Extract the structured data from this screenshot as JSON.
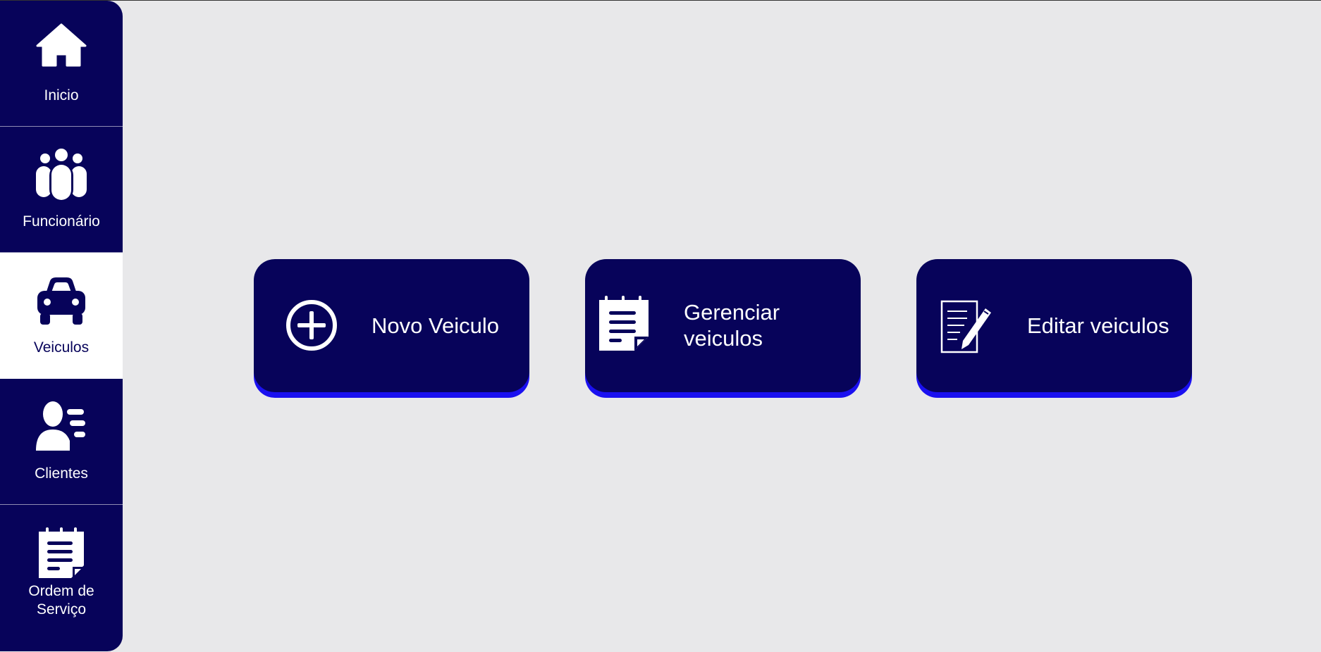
{
  "sidebar": {
    "items": [
      {
        "label": "Inicio",
        "icon": "home-icon"
      },
      {
        "label": "Funcionário",
        "icon": "people-group-icon"
      },
      {
        "label": "Veiculos",
        "icon": "car-icon",
        "active": true
      },
      {
        "label": "Clientes",
        "icon": "client-list-icon"
      },
      {
        "label": "Ordem de Serviço",
        "icon": "notepad-icon"
      }
    ]
  },
  "main": {
    "cards": [
      {
        "label": "Novo Veiculo",
        "icon": "plus-circle-icon"
      },
      {
        "label": "Gerenciar veiculos",
        "icon": "notepad-icon"
      },
      {
        "label": "Editar veiculos",
        "icon": "document-pencil-icon"
      }
    ]
  },
  "colors": {
    "navy": "#07035a",
    "accent_shadow": "#1a10f0",
    "background": "#e8e8ea",
    "active_item_bg": "#ffffff"
  }
}
